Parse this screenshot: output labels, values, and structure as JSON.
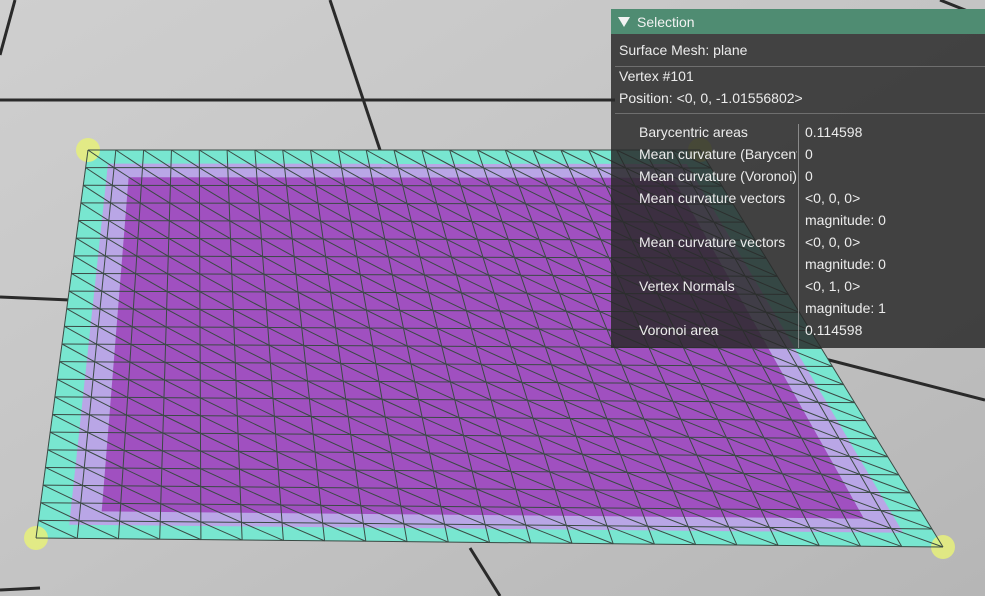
{
  "panel": {
    "title": "Selection",
    "mesh_label": "Surface Mesh: plane",
    "vertex_label": "Vertex #101",
    "position_label": "Position: <0, 0, -1.01556802>",
    "quantities": [
      {
        "name": "Barycentric areas",
        "value": "0.114598",
        "extra": ""
      },
      {
        "name": "Mean curvature (Barycentric)",
        "value": "0",
        "extra": ""
      },
      {
        "name": "Mean curvature (Voronoi)",
        "value": "0",
        "extra": ""
      },
      {
        "name": "Mean curvature vectors",
        "value": "<0, 0, 0>",
        "extra": "magnitude: 0"
      },
      {
        "name": "Mean curvature vectors",
        "value": "<0, 0, 0>",
        "extra": "magnitude: 0"
      },
      {
        "name": "Vertex Normals",
        "value": "<0, 1, 0>",
        "extra": "magnitude: 1"
      },
      {
        "name": "Voronoi area",
        "value": "0.114598",
        "extra": ""
      }
    ]
  },
  "scene": {
    "colors": {
      "ground_light": "#d0d0d0",
      "ground_dark": "#b3b3b3",
      "grout": "#2a2a2a",
      "mesh_interior": "#a050c0",
      "mesh_edge_cyan": "#78e6d0",
      "mesh_corner_yellow": "#e6f07a",
      "wire": "#3a4a44"
    },
    "grid_divisions": 22
  }
}
